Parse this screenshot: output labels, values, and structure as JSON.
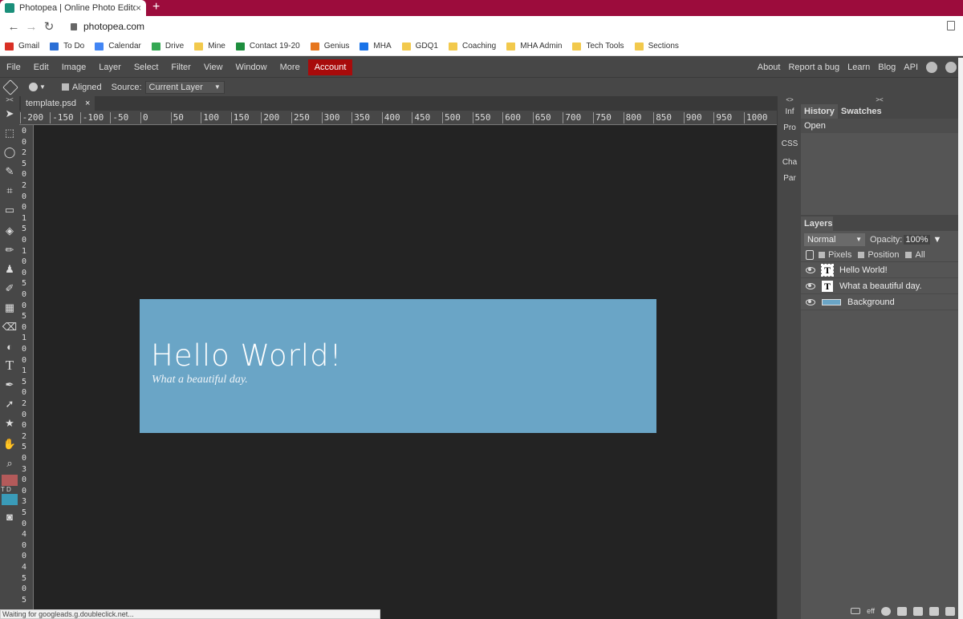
{
  "browser": {
    "tab_title": "Photopea | Online Photo Editor",
    "tab_close": "×",
    "new_tab": "+",
    "url": "photopea.com",
    "bookmarks": [
      {
        "label": "Gmail",
        "color": "#d93025"
      },
      {
        "label": "To Do",
        "color": "#2b6fd6"
      },
      {
        "label": "Calendar",
        "color": "#4285f4"
      },
      {
        "label": "Drive",
        "color": "#34a853"
      },
      {
        "label": "Mine",
        "color": "#f2c94c"
      },
      {
        "label": "Contact 19-20",
        "color": "#1e8e3e"
      },
      {
        "label": "Genius",
        "color": "#e6761d"
      },
      {
        "label": "MHA",
        "color": "#1a73e8"
      },
      {
        "label": "GDQ1",
        "color": "#f2c94c"
      },
      {
        "label": "Coaching",
        "color": "#f2c94c"
      },
      {
        "label": "MHA Admin",
        "color": "#f2c94c"
      },
      {
        "label": "Tech Tools",
        "color": "#f2c94c"
      },
      {
        "label": "Sections",
        "color": "#f2c94c"
      }
    ],
    "status_text": "Waiting for googleads.g.doubleclick.net..."
  },
  "menu": {
    "items": [
      "File",
      "Edit",
      "Image",
      "Layer",
      "Select",
      "Filter",
      "View",
      "Window",
      "More"
    ],
    "account": "Account",
    "right": [
      "About",
      "Report a bug",
      "Learn",
      "Blog",
      "API"
    ]
  },
  "options": {
    "aligned": "Aligned",
    "source_label": "Source:",
    "source_value": "Current Layer"
  },
  "document": {
    "tab_name": "template.psd",
    "tab_close": "×",
    "h_ruler": [
      "-200",
      "-150",
      "-100",
      "-50",
      "0",
      "50",
      "100",
      "150",
      "200",
      "250",
      "300",
      "350",
      "400",
      "450",
      "500",
      "550",
      "600",
      "650",
      "700",
      "750",
      "800",
      "850",
      "900",
      "950",
      "1000"
    ],
    "v_ruler": [
      "0",
      "0",
      "2",
      "5",
      "0",
      "2",
      "0",
      "0",
      "1",
      "5",
      "0",
      "1",
      "0",
      "0",
      "5",
      "0",
      "0",
      "5",
      "0",
      "1",
      "0",
      "0",
      "1",
      "5",
      "0",
      "2",
      "0",
      "0",
      "2",
      "5",
      "0",
      "3",
      "0",
      "0",
      "3",
      "5",
      "0",
      "4",
      "0",
      "0",
      "4",
      "5",
      "0",
      "5"
    ],
    "headline": "Hello World!",
    "tagline": "What a beautiful day.",
    "artboard_color": "#6aa5c6"
  },
  "mini_panel": {
    "toggle": "<>",
    "items": [
      "Inf",
      "Pro",
      "CSS",
      "Cha",
      "Par"
    ]
  },
  "panels": {
    "toggle": "><",
    "history_tab": "History",
    "swatches_tab": "Swatches",
    "history_items": [
      "Open"
    ],
    "layers_tab": "Layers",
    "blend_mode": "Normal",
    "opacity_label": "Opacity:",
    "opacity_value": "100%",
    "lock_options": [
      "Pixels",
      "Position",
      "All"
    ],
    "layers": [
      "Hello World!",
      "What a beautiful day.",
      "Background"
    ],
    "bottom_eff": "eff"
  },
  "tools": {
    "toggle": "><",
    "fg_color": "#b35a5a",
    "bg_color": "#3a9bb8",
    "swatch_label": "T D"
  }
}
